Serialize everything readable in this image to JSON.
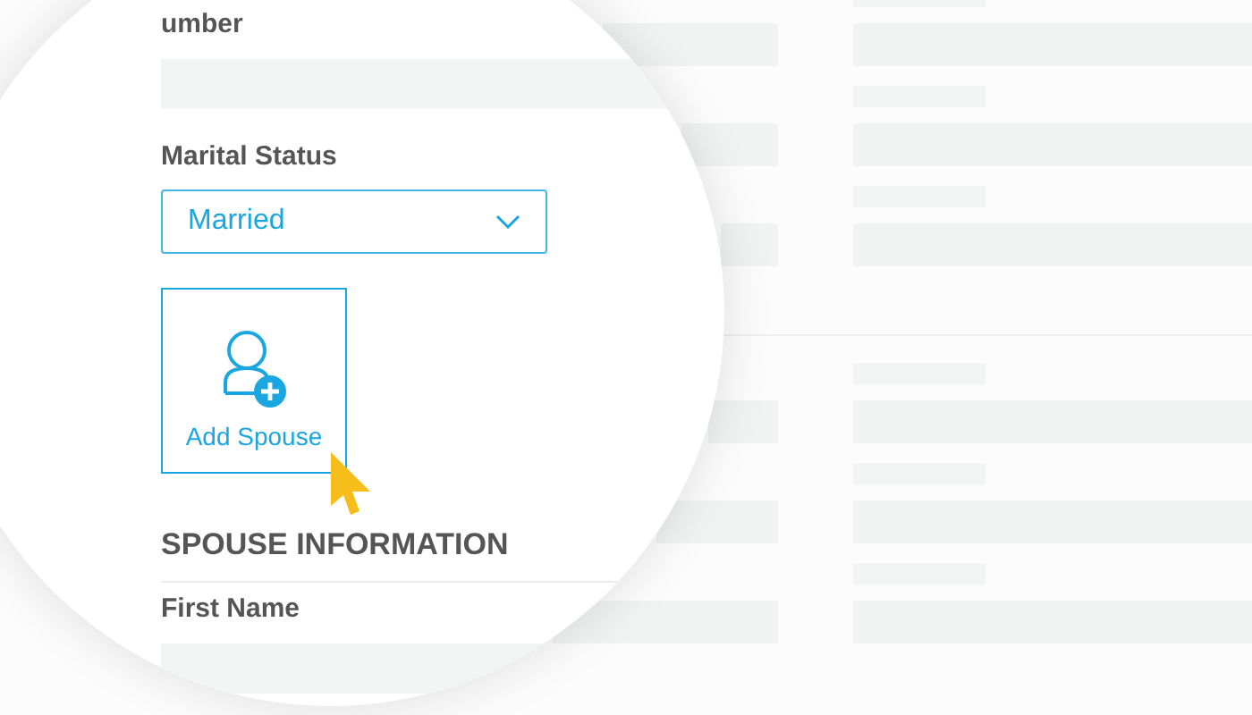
{
  "partial_label": "umber",
  "marital_status": {
    "label": "Marital Status",
    "value": "Married"
  },
  "add_spouse_button": {
    "label": "Add Spouse"
  },
  "section_title": "SPOUSE INFORMATION",
  "first_name": {
    "label": "First Name"
  }
}
